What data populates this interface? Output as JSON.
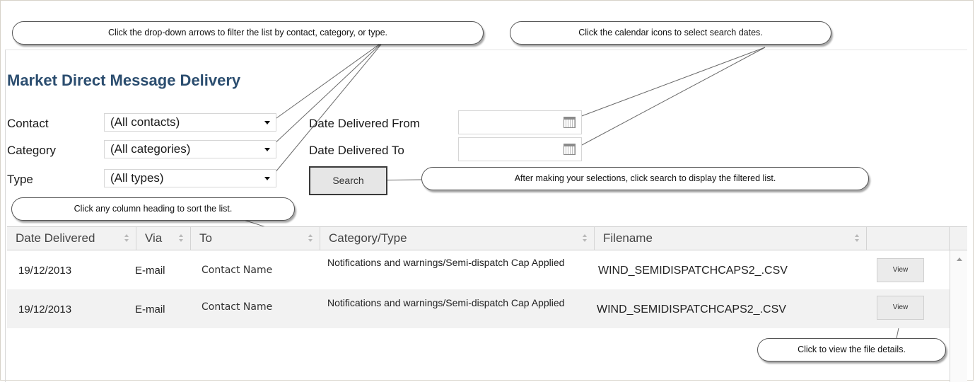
{
  "header": {
    "title": "Market Direct Message Delivery"
  },
  "filters": {
    "contact_label": "Contact",
    "contact_value": "(All contacts)",
    "category_label": "Category",
    "category_value": "(All categories)",
    "type_label": "Type",
    "type_value": "(All types)",
    "date_from_label": "Date Delivered From",
    "date_to_label": "Date Delivered To",
    "search_label": "Search"
  },
  "callouts": {
    "dropdowns": "Click the drop-down arrows to filter the list by contact, category, or type.",
    "calendar": "Click the calendar icons to select search dates.",
    "search": "After making your selections, click search to display the filtered list.",
    "sort": "Click any column heading to sort the list.",
    "view": "Click to view the file details."
  },
  "table": {
    "columns": [
      "Date Delivered",
      "Via",
      "To",
      "Category/Type",
      "Filename"
    ],
    "rows": [
      {
        "date": "19/12/2013",
        "via": "E-mail",
        "to": "Contact Name",
        "category": "Notifications and warnings/Semi-dispatch Cap Applied",
        "filename": "WIND_SEMIDISPATCHCAPS2_.CSV",
        "action": "View"
      },
      {
        "date": "19/12/2013",
        "via": "E-mail",
        "to": "Contact Name",
        "category": "Notifications and warnings/Semi-dispatch Cap Applied",
        "filename": "WIND_SEMIDISPATCHCAPS2_.CSV",
        "action": "View"
      }
    ]
  },
  "icons": [
    "dropdown-arrow-icon",
    "calendar-icon",
    "sort-icon",
    "scroll-up-icon"
  ]
}
